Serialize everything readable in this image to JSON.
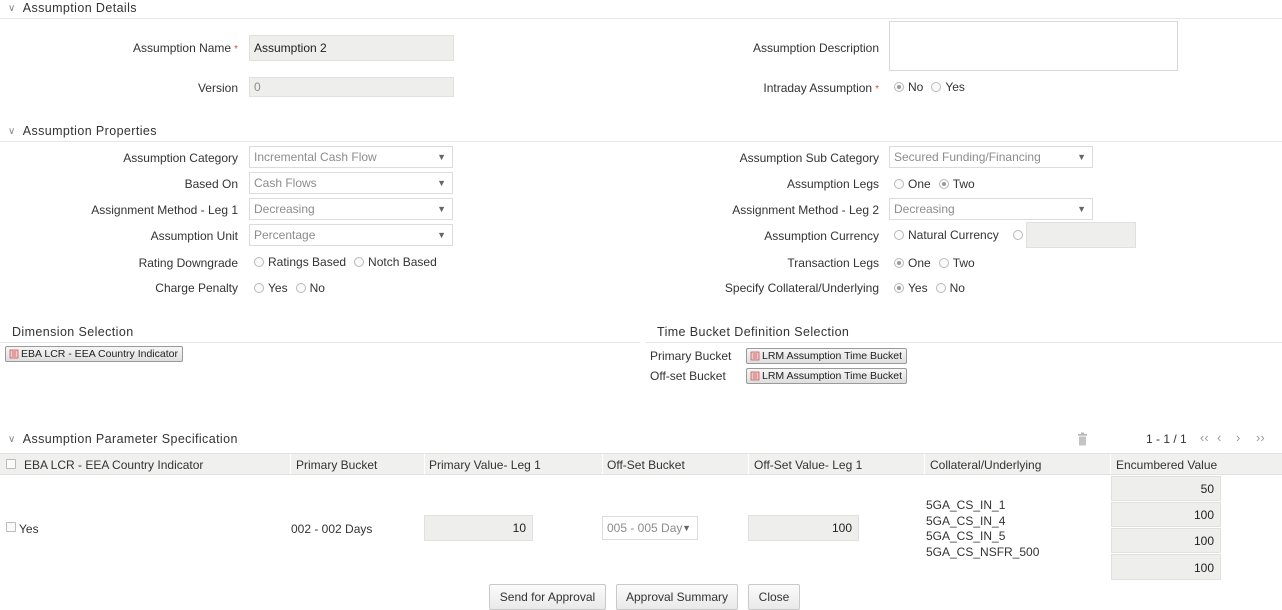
{
  "assumption_details": {
    "header": "Assumption Details",
    "name_label": "Assumption Name",
    "name_value": "Assumption 2",
    "version_label": "Version",
    "version_value": "0",
    "description_label": "Assumption Description",
    "description_value": "",
    "intraday_label": "Intraday Assumption",
    "intraday_options": [
      "No",
      "Yes"
    ],
    "intraday_selected": "No",
    "required_marker": "*"
  },
  "assumption_properties": {
    "header": "Assumption Properties",
    "category_label": "Assumption Category",
    "category_value": "Incremental Cash Flow",
    "based_on_label": "Based On",
    "based_on_value": "Cash Flows",
    "method_leg1_label": "Assignment Method - Leg 1",
    "method_leg1_value": "Decreasing",
    "unit_label": "Assumption Unit",
    "unit_value": "Percentage",
    "rating_label": "Rating Downgrade",
    "rating_options": [
      "Ratings Based",
      "Notch Based"
    ],
    "penalty_label": "Charge Penalty",
    "penalty_options": [
      "Yes",
      "No"
    ],
    "sub_category_label": "Assumption Sub Category",
    "sub_category_value": "Secured Funding/Financing",
    "legs_label": "Assumption Legs",
    "legs_options": [
      "One",
      "Two"
    ],
    "legs_selected": "Two",
    "method_leg2_label": "Assignment Method - Leg 2",
    "method_leg2_value": "Decreasing",
    "currency_label": "Assumption Currency",
    "currency_option": "Natural Currency",
    "currency_value": "",
    "transaction_legs_label": "Transaction Legs",
    "transaction_legs_options": [
      "One",
      "Two"
    ],
    "transaction_legs_selected": "One",
    "collateral_label": "Specify Collateral/Underlying",
    "collateral_options": [
      "Yes",
      "No"
    ],
    "collateral_selected": "Yes"
  },
  "dimension_selection": {
    "header": "Dimension Selection",
    "chip": "EBA LCR - EEA Country Indicator"
  },
  "time_bucket": {
    "header": "Time Bucket Definition Selection",
    "primary_label": "Primary Bucket",
    "primary_chip": "LRM Assumption Time Bucket",
    "offset_label": "Off-set Bucket",
    "offset_chip": "LRM Assumption Time Bucket"
  },
  "parameter_spec": {
    "header": "Assumption Parameter Specification",
    "pagination": "1 - 1 / 1",
    "columns": [
      "EBA LCR - EEA Country Indicator",
      "Primary Bucket",
      "Primary Value- Leg 1",
      "Off-Set Bucket",
      "Off-Set Value- Leg 1",
      "Collateral/Underlying",
      "Encumbered Value"
    ],
    "row": {
      "indicator": "Yes",
      "primary_bucket": "002 - 002 Days",
      "primary_value": "10",
      "offset_bucket": "005 - 005 Day",
      "offset_value": "100",
      "collaterals": [
        "5GA_CS_IN_1",
        "5GA_CS_IN_4",
        "5GA_CS_IN_5",
        "5GA_CS_NSFR_500"
      ],
      "encumbered": [
        "50",
        "100",
        "100",
        "100"
      ]
    }
  },
  "buttons": {
    "send": "Send for Approval",
    "summary": "Approval Summary",
    "close": "Close"
  }
}
